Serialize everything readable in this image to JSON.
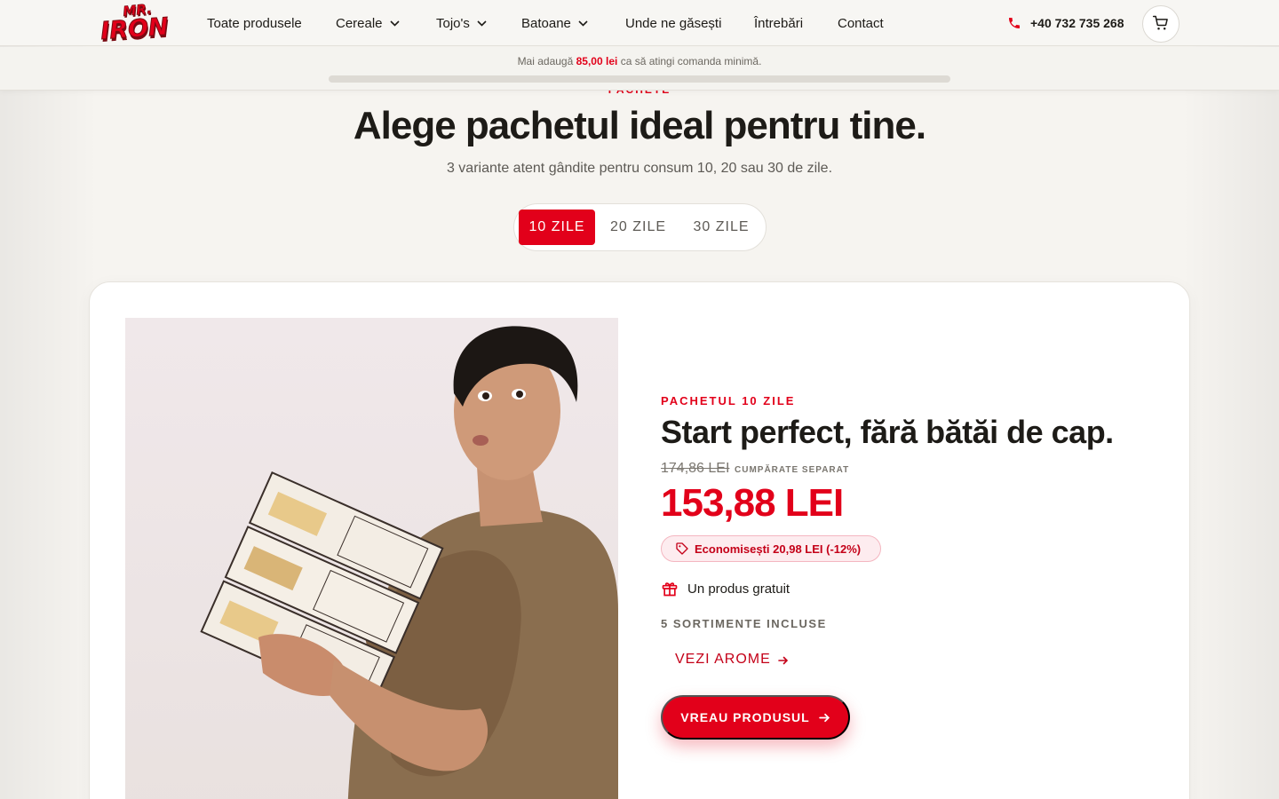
{
  "header": {
    "logo_text": "MR. IRON",
    "nav": [
      {
        "label": "Toate produsele",
        "has_dropdown": false
      },
      {
        "label": "Cereale",
        "has_dropdown": true
      },
      {
        "label": "Tojo's",
        "has_dropdown": true
      },
      {
        "label": "Batoane",
        "has_dropdown": true
      },
      {
        "label": "Unde ne găsești",
        "has_dropdown": false
      },
      {
        "label": "Întrebări",
        "has_dropdown": false
      },
      {
        "label": "Contact",
        "has_dropdown": false
      }
    ],
    "phone": "+40 732 735 268",
    "phone_icon": "phone-icon",
    "cart_icon": "cart-icon"
  },
  "min_order": {
    "prefix": "Mai adaugă",
    "amount": "85,00 lei",
    "suffix": "ca să atingi comanda minimă.",
    "progress": 0
  },
  "hero": {
    "eyebrow": "PACHETE",
    "title": "Alege pachetul ideal pentru tine.",
    "subtitle": "3 variante atent gândite pentru consum 10, 20 sau 30 de zile."
  },
  "tabs": [
    {
      "label": "10 ZILE",
      "active": true
    },
    {
      "label": "20 ZILE",
      "active": false
    },
    {
      "label": "30 ZILE",
      "active": false
    }
  ],
  "package": {
    "label": "PACHETUL 10 ZILE",
    "title": "Start perfect, fără bătăi de cap.",
    "old_price": "174,86 LEI",
    "old_price_note": "CUMPĂRATE SEPARAT",
    "price": "153,88 LEI",
    "savings": "Economisești 20,98 LEI (-12%)",
    "savings_icon": "tag-icon",
    "gift": "Un produs gratuit",
    "gift_icon": "gift-icon",
    "assortments": "5 SORTIMENTE INCLUSE",
    "aromas_link": "VEZI AROME",
    "cta": "VREAU PRODUSUL"
  },
  "colors": {
    "accent": "#e2001a",
    "background": "#f6f4f0",
    "card": "#ffffff",
    "text": "#1d1b17"
  }
}
